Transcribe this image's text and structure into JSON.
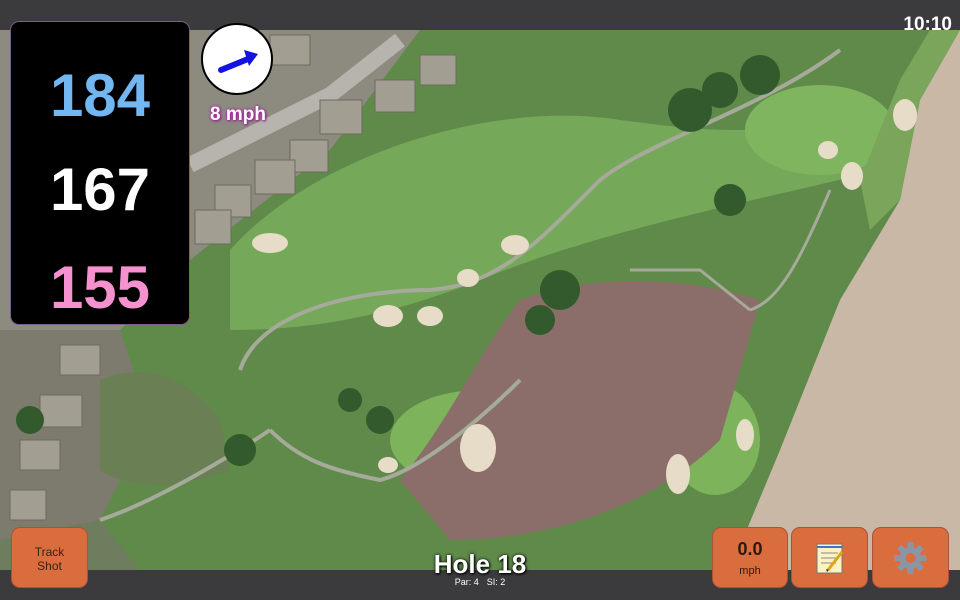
{
  "status_bar": {
    "time": "10:10"
  },
  "distances": {
    "back": "184",
    "middle": "167",
    "front": "155"
  },
  "wind": {
    "speed_label": "8 mph",
    "direction_icon": "arrow-icon"
  },
  "hole": {
    "title": "Hole 18",
    "par": "Par: 4",
    "stroke_index": "SI: 2"
  },
  "buttons": {
    "track_shot": "Track\nShot",
    "speed_value": "0.0",
    "speed_unit": "mph",
    "notes_icon": "notepad-icon",
    "settings_icon": "gear-icon"
  },
  "colors": {
    "back_distance": "#72b6f2",
    "middle_distance": "#ffffff",
    "front_distance": "#f591cf",
    "button_orange": "#d96d3e",
    "wind_text_outline": "#b02aa5",
    "wind_arrow": "#1414e0"
  }
}
